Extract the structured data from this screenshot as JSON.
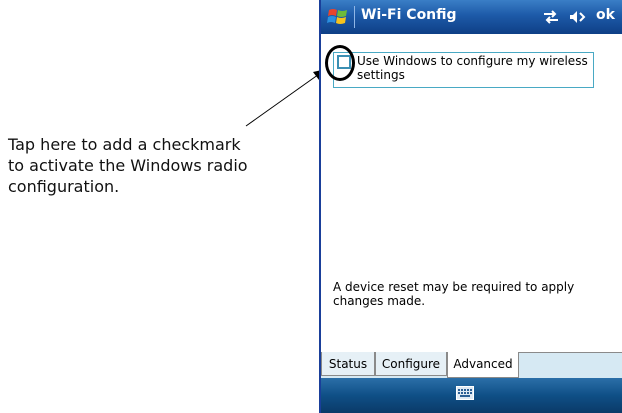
{
  "annotation": {
    "callout_text": "Tap here to add a checkmark\nto activate the Windows radio\nconfiguration."
  },
  "window": {
    "title": "Wi-Fi Config",
    "ok_label": "ok"
  },
  "settings": {
    "use_windows_label": "Use Windows to configure my wireless settings",
    "use_windows_checked": false
  },
  "note": "A device reset may be required to apply changes made.",
  "tabs": [
    {
      "label": "Status",
      "active": false
    },
    {
      "label": "Configure",
      "active": false
    },
    {
      "label": "Advanced",
      "active": true
    }
  ],
  "colors": {
    "titlebar": "#1d5aa8",
    "accent_border": "#49a9c4",
    "tabbar": "#d6e9f3"
  },
  "icons": {
    "start": "windows-flag-icon",
    "connectivity": "connectivity-arrows-icon",
    "volume": "speaker-muted-icon",
    "sip": "keyboard-icon"
  }
}
